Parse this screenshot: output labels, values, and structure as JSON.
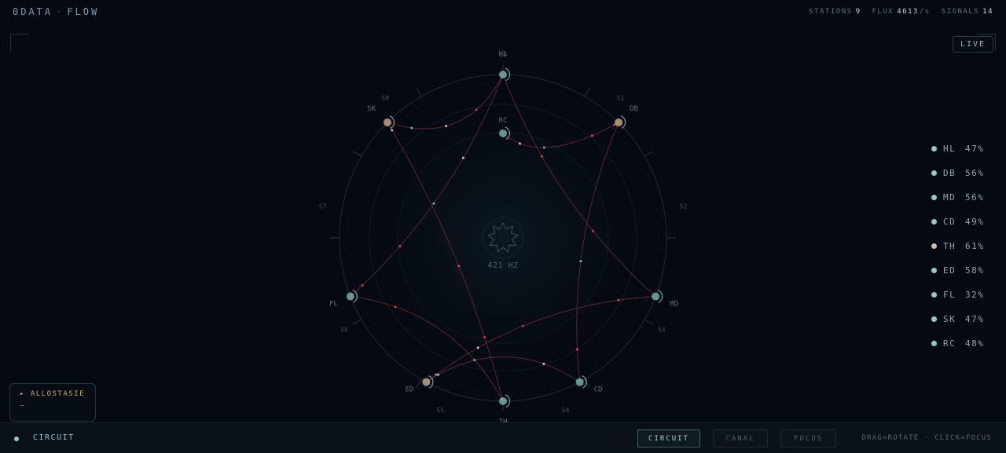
{
  "header": {
    "brand_left": "0DATA",
    "brand_sep": "·",
    "brand_right": "FLOW",
    "stats": {
      "stations_label": "STATIONS",
      "stations_value": "9",
      "flux_label": "FLUX",
      "flux_value": "4613",
      "flux_unit": "/s",
      "signals_label": "SIGNALS",
      "signals_value": "14"
    }
  },
  "live_label": "LIVE",
  "center": {
    "frequency": "421 HZ"
  },
  "stations": [
    {
      "id": "HL",
      "angle": 0,
      "r": 1.0,
      "color": "#7fc4b3",
      "label_pos": "top"
    },
    {
      "id": "DB",
      "angle": 45,
      "r": 1.0,
      "color": "#d6b89c",
      "label_pos": "right-top"
    },
    {
      "id": "MD",
      "angle": 111,
      "r": 1.0,
      "color": "#7fc4b3",
      "label_pos": "right-bottom"
    },
    {
      "id": "CD",
      "angle": 152,
      "r": 1.0,
      "color": "#7fc4b3",
      "label_pos": "right-bottom"
    },
    {
      "id": "TH",
      "angle": 180,
      "r": 1.0,
      "color": "#7fc4b3",
      "label_pos": "bottom"
    },
    {
      "id": "ED",
      "angle": 208,
      "r": 1.0,
      "color": "#d6b89c",
      "label_pos": "left-bottom"
    },
    {
      "id": "FL",
      "angle": 249,
      "r": 1.0,
      "color": "#7fc4b3",
      "label_pos": "left-bottom"
    },
    {
      "id": "SK",
      "angle": 315,
      "r": 1.0,
      "color": "#d6b89c",
      "label_pos": "left-top"
    },
    {
      "id": "RC",
      "angle": 0,
      "r": 0.64,
      "color": "#7fc4b3",
      "label_pos": "top"
    }
  ],
  "sectors": [
    "S0",
    "S1",
    "S2",
    "S3",
    "S4",
    "S5",
    "S6",
    "S7",
    "S8"
  ],
  "links": [
    [
      "HL",
      "MD"
    ],
    [
      "HL",
      "SK"
    ],
    [
      "HL",
      "FL"
    ],
    [
      "DB",
      "CD"
    ],
    [
      "SK",
      "TH"
    ],
    [
      "MD",
      "ED"
    ],
    [
      "ED",
      "CD"
    ],
    [
      "FL",
      "TH"
    ],
    [
      "RC",
      "DB"
    ]
  ],
  "legend": [
    {
      "code": "HL",
      "value": "47%",
      "color": "#8fcfbd"
    },
    {
      "code": "DB",
      "value": "56%",
      "color": "#8fcfbd"
    },
    {
      "code": "MD",
      "value": "56%",
      "color": "#8fcfbd"
    },
    {
      "code": "CD",
      "value": "49%",
      "color": "#8fcfbd"
    },
    {
      "code": "TH",
      "value": "61%",
      "color": "#e0b89a"
    },
    {
      "code": "ED",
      "value": "58%",
      "color": "#8fcfbd"
    },
    {
      "code": "FL",
      "value": "32%",
      "color": "#8fcfbd"
    },
    {
      "code": "SK",
      "value": "47%",
      "color": "#8fcfbd"
    },
    {
      "code": "RC",
      "value": "48%",
      "color": "#8fcfbd"
    }
  ],
  "panel": {
    "title": "▸ ALLOSTASIE",
    "value": "—"
  },
  "bottom": {
    "status_label": "CIRCUIT",
    "modes": [
      "CIRCUIT",
      "CANAL",
      "FOCUS"
    ],
    "active_mode": "CIRCUIT",
    "hint": "DRAG=ROTATE · CLICK=FOCUS"
  },
  "colors": {
    "teal": "#7fc4b3",
    "sand": "#d6b89c",
    "link": "#6b2a35",
    "particle": "#e0425e"
  }
}
